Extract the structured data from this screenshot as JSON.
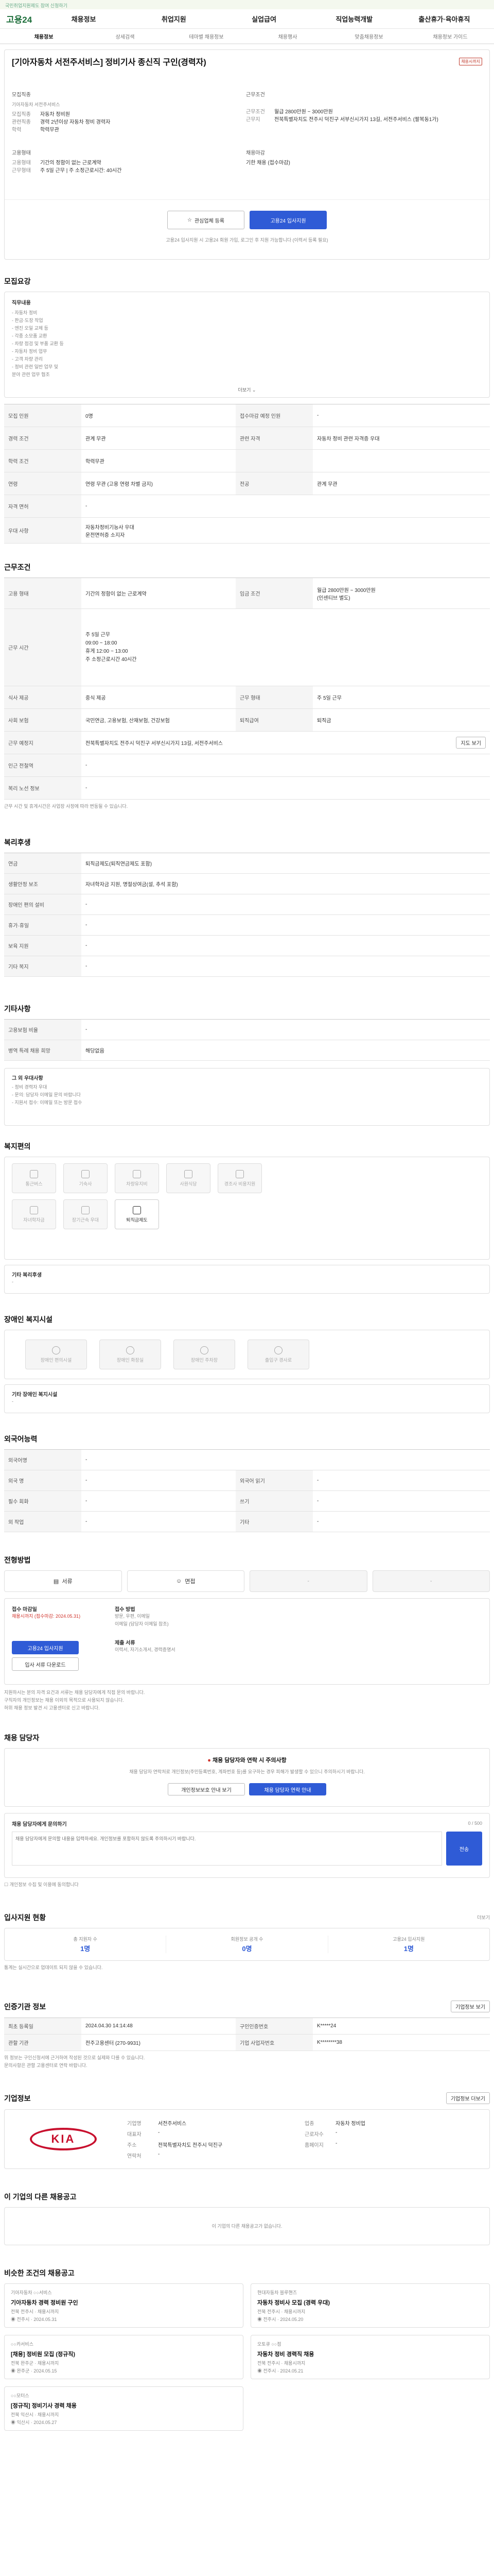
{
  "topbar": {
    "text": "국민취업지원제도 참여 신청하기"
  },
  "gnb": {
    "logo": "고용24",
    "items": [
      "채용정보",
      "취업지원",
      "실업급여",
      "직업능력개발",
      "출산휴가·육아휴직"
    ]
  },
  "tabs": [
    "채용정보",
    "상세검색",
    "테마별 채용정보",
    "채용행사",
    "맞춤채용정보",
    "채용정보 가이드"
  ],
  "job": {
    "title": "[기아자동차 서전주서비스] 정비기사 종신직 구인(경력자)",
    "badge": "채용시까지",
    "company_label": "모집직종",
    "company": "기아자동차 서전주서비스",
    "company_rows": [
      {
        "k": "모집직종",
        "v": "자동차 정비원"
      },
      {
        "k": "관련직종",
        "v": "경력 2년이상 자동차 정비 경력자"
      },
      {
        "k": "학력",
        "v": "학력무관"
      }
    ],
    "condition_rows": [
      {
        "k": "근무조건",
        "v": "월급 2800만원 ~ 3000만원"
      },
      {
        "k": "근무지",
        "v": "전북특별자치도 전주시 덕진구 서부신시가지 13길, 서전주서비스 (팔복동1가)"
      }
    ],
    "employ_rows": [
      {
        "k": "고용형태",
        "v": "기간의 정함이 없는 근로계약"
      },
      {
        "k": "근무형태",
        "v": "주 5일 근무 | 주 소정근로시간: 40시간"
      }
    ],
    "deadline_label": "채용마감",
    "deadline": "기한 채용 (접수마감)",
    "scrap_btn": "관심업체 등록",
    "apply_btn": "고용24 입사지원",
    "apply_notice": "고용24 입사지원 시 고용24 회원 가입, 로그인 후 지원 가능합니다 (이력서 등록 필요)"
  },
  "recruit": {
    "title": "모집요강",
    "duty_label": "직무내용",
    "duties": [
      "- 자동차 정비",
      "- 판금·도장 작업",
      "- 엔진 오일 교체 등",
      "- 각종 소모품 교환",
      "- 차량 점검 및 부품 교환 등",
      "- 자동차 정비 업무",
      "- 고객 차량 관리",
      "- 정비 관련 일반 업무 및",
      "  분야 관련 업무 협조"
    ],
    "more": "더보기",
    "rows": [
      {
        "k": "모집 인원",
        "v": "0명",
        "k2": "접수마감 예정 인원",
        "v2": "-"
      },
      {
        "k": "경력 조건",
        "v": "관계 무관",
        "k2": "관련 자격",
        "v2": "자동차 정비 관련 자격증 우대"
      },
      {
        "k": "학력 조건",
        "v": "학력무관",
        "k2": "",
        "v2": ""
      },
      {
        "k": "연령",
        "v": "연령 무관 (고용 연령 차별 금지)",
        "k2": "전공",
        "v2": "관계 무관"
      },
      {
        "k": "자격 면허",
        "v": "-",
        "k2": "",
        "v2": ""
      },
      {
        "k": "우대 사항",
        "v": "자동차정비기능사 우대\n운전면허증 소지자",
        "k2": "",
        "v2": ""
      }
    ]
  },
  "work": {
    "title": "근무조건",
    "rows": [
      {
        "k": "고용 형태",
        "v": "기간의 정함이 없는 근로계약",
        "k2": "임금 조건",
        "v2": "월급 2800만원 ~ 3000만원\n(인센티브 별도)"
      },
      {
        "k": "근무 시간",
        "v": "주 5일 근무\n09:00 ~ 18:00\n휴게 12:00 ~ 13:00\n주 소정근로시간 40시간",
        "k2": "",
        "v2": ""
      },
      {
        "k": "식사 제공",
        "v": "중식 제공",
        "k2": "근무 형태",
        "v2": "주 5일 근무"
      },
      {
        "k": "사회 보험",
        "v": "국민연금, 고용보험, 산재보험, 건강보험",
        "k2": "퇴직급여",
        "v2": "퇴직금"
      },
      {
        "k": "근무 예정지",
        "v": "전북특별자치도 전주시 덕진구 서부신시가지 13길, 서전주서비스",
        "k2": "",
        "v2": "지도 보기"
      },
      {
        "k": "인근 전철역",
        "v": "-",
        "k2": "",
        "v2": ""
      },
      {
        "k": "복리 노선 정보",
        "v": "-",
        "k2": "",
        "v2": ""
      }
    ],
    "note": "근무 시간 및 휴게시간은 사업장 사정에 따라 변동될 수 있습니다."
  },
  "welfare": {
    "title": "복리후생",
    "rows": [
      {
        "k": "연금",
        "v": "퇴직금제도(퇴직연금제도 포함)"
      },
      {
        "k": "생활안정 보조",
        "v": "자녀학자금 지원, 명절상여금(설, 추석 포함)"
      },
      {
        "k": "장애인 편의 설비",
        "v": "-"
      },
      {
        "k": "휴가·휴일",
        "v": "-"
      },
      {
        "k": "보육 지원",
        "v": "-"
      },
      {
        "k": "기타 복지",
        "v": "-"
      }
    ]
  },
  "etc": {
    "title": "기타사항",
    "rows": [
      {
        "k": "고용보험 비율",
        "v": "-"
      },
      {
        "k": "병역 특례 채용 희망",
        "v": "해당없음"
      }
    ],
    "extra_title": "그 외 우대사항",
    "extra_lines": [
      "- 정비 경력자 우대",
      "- 문의: 담당자 이메일 문의 바랍니다",
      "- 지원서 접수: 이메일 또는 방문 접수"
    ]
  },
  "facility": {
    "title": "복지편의",
    "tiles": [
      {
        "label": "통근버스",
        "icon": "bus-icon",
        "on": false
      },
      {
        "label": "기숙사",
        "icon": "dorm-icon",
        "on": false
      },
      {
        "label": "차량유지비",
        "icon": "car-icon",
        "on": false
      },
      {
        "label": "사원식당",
        "icon": "cafeteria-icon",
        "on": false
      },
      {
        "label": "경조사 비용지원",
        "icon": "gift-icon",
        "on": false
      },
      {
        "label": "자녀학자금",
        "icon": "education-icon",
        "on": false
      },
      {
        "label": "장기근속 우대",
        "icon": "award-icon",
        "on": false
      },
      {
        "label": "퇴직금제도",
        "icon": "retirement-icon",
        "on": true
      }
    ],
    "note_label": "기타 복리후생",
    "note": "-"
  },
  "disabled": {
    "title": "장애인 복지시설",
    "tiles": [
      "장애인 편의시설",
      "장애인 화장실",
      "장애인 주차장",
      "출입구 경사로"
    ],
    "note_label": "기타 장애인 복지시설",
    "note": "-"
  },
  "lang": {
    "title": "외국어능력",
    "rows": [
      {
        "k": "외국어명",
        "v": "-",
        "k2": "",
        "v2": ""
      },
      {
        "k": "외국 명",
        "v": "-",
        "k2": "외국어 읽기",
        "v2": "-"
      },
      {
        "k": "필수 회화",
        "v": "-",
        "k2": "쓰기",
        "v2": "-"
      },
      {
        "k": "외 작업",
        "v": "-",
        "k2": "기타",
        "v2": "-"
      }
    ]
  },
  "process": {
    "title": "전형방법",
    "steps": [
      "서류",
      "면접",
      "-",
      "-"
    ],
    "doc_label": "접수 마감일",
    "doc_value": "채용시까지 (접수마감: 2024.05.31)",
    "method_label": "접수 방법",
    "method_value": "방문, 우편, 이메일\n이메일 (담당자 이메일 참조)",
    "form_label": "제출 서류",
    "form_value": "이력서, 자기소개서, 경력증명서",
    "btn_apply": "고용24 입사지원",
    "btn_form": "입사 서류 다운로드",
    "notes": [
      "지원하시는 분의 자격 요건과 서류는 채용 담당자에게 직접 문의 바랍니다.",
      "구직자의 개인정보는 채용 이외의 목적으로 사용되지 않습니다.",
      "허위 채용 정보 발견 시 고용센터로 신고 바랍니다."
    ]
  },
  "manager": {
    "title": "채용 담당자",
    "warn_title": "채용 담당자와 연락 시 주의사항",
    "warn_text": "채용 담당자 연락처로 개인정보(주민등록번호, 계좌번호 등)를 요구하는 경우 피해가 발생할 수 있으니 주의하시기 바랍니다.",
    "btn_more": "개인정보보호 안내 보기",
    "btn_contact": "채용 담당자 연락 안내",
    "inquiry_label": "채용 담당자에게 문의하기",
    "inquiry_placeholder": "채용 담당자에게 문의할 내용을 입력하세요. 개인정보를 포함하지 않도록 주의하시기 바랍니다.",
    "inquiry_counter": "0 / 500",
    "inquiry_btn": "전송",
    "agree": "개인정보 수집 및 이용에 동의합니다"
  },
  "stats": {
    "title": "입사지원 현황",
    "more": "더보기",
    "items": [
      {
        "label": "총 지원자 수",
        "value": "1명"
      },
      {
        "label": "회원정보 공개 수",
        "value": "0명"
      },
      {
        "label": "고용24 입사지원",
        "value": "1명"
      }
    ],
    "note": "통계는 실시간으로 업데이트 되지 않을 수 있습니다."
  },
  "register": {
    "title": "인증기관 정보",
    "btn": "기업정보 보기",
    "rows": [
      {
        "k": "최초 등록일",
        "v": "2024.04.30 14:14:48",
        "k2": "구인인증번호",
        "v2": "K*****24"
      },
      {
        "k": "관할 기관",
        "v": "전주고용센터 (270-9931)",
        "k2": "기업 사업자번호",
        "v2": "K********38"
      }
    ],
    "notes": [
      "위 정보는 구인신청서에 근거하여 작성된 것으로 실제와 다를 수 있습니다.",
      "문의사항은 관할 고용센터로 연락 바랍니다."
    ]
  },
  "company": {
    "title": "기업정보",
    "btn": "기업정보 더보기",
    "logo_text": "KIA",
    "rows": [
      {
        "k": "기업명",
        "v": "서전주서비스",
        "k2": "업종",
        "v2": "자동차 정비업"
      },
      {
        "k": "대표자",
        "v": "-",
        "k2": "근로자수",
        "v2": "-"
      },
      {
        "k": "주소",
        "v": "전북특별자치도 전주시 덕진구",
        "k2": "홈페이지",
        "v2": "-"
      },
      {
        "k": "연락처",
        "v": "-",
        "k2": "",
        "v2": ""
      }
    ]
  },
  "same_company": {
    "title": "이 기업의 다른 채용공고",
    "empty": "이 기업의 다른 채용공고가 없습니다."
  },
  "similar": {
    "title": "비슷한 조건의 채용공고",
    "cards": [
      {
        "org": "기아자동차 ○○서비스",
        "title": "기아자동차 경력 정비원 구인",
        "meta": "전북 전주시 · 채용시까지",
        "region": "전주시",
        "date": "2024.05.31"
      },
      {
        "org": "현대자동차 블루핸즈",
        "title": "자동차 정비사 모집 (경력 우대)",
        "meta": "전북 전주시 · 채용시까지",
        "region": "전주시",
        "date": "2024.05.20"
      },
      {
        "org": "○○카서비스",
        "title": "[채용] 정비원 모집 (정규직)",
        "meta": "전북 완주군 · 채용시까지",
        "region": "완주군",
        "date": "2024.05.15"
      },
      {
        "org": "오토큐 ○○점",
        "title": "자동차 정비 경력직 채용",
        "meta": "전북 전주시 · 채용시까지",
        "region": "전주시",
        "date": "2024.05.21"
      },
      {
        "org": "○○모터스",
        "title": "[정규직] 정비기사 경력 채용",
        "meta": "전북 익산시 · 채용시까지",
        "region": "익산시",
        "date": "2024.05.27"
      }
    ]
  },
  "colors": {
    "accent": "#1d7a3e",
    "primary": "#2f5bd6",
    "warn": "#d0342c"
  }
}
